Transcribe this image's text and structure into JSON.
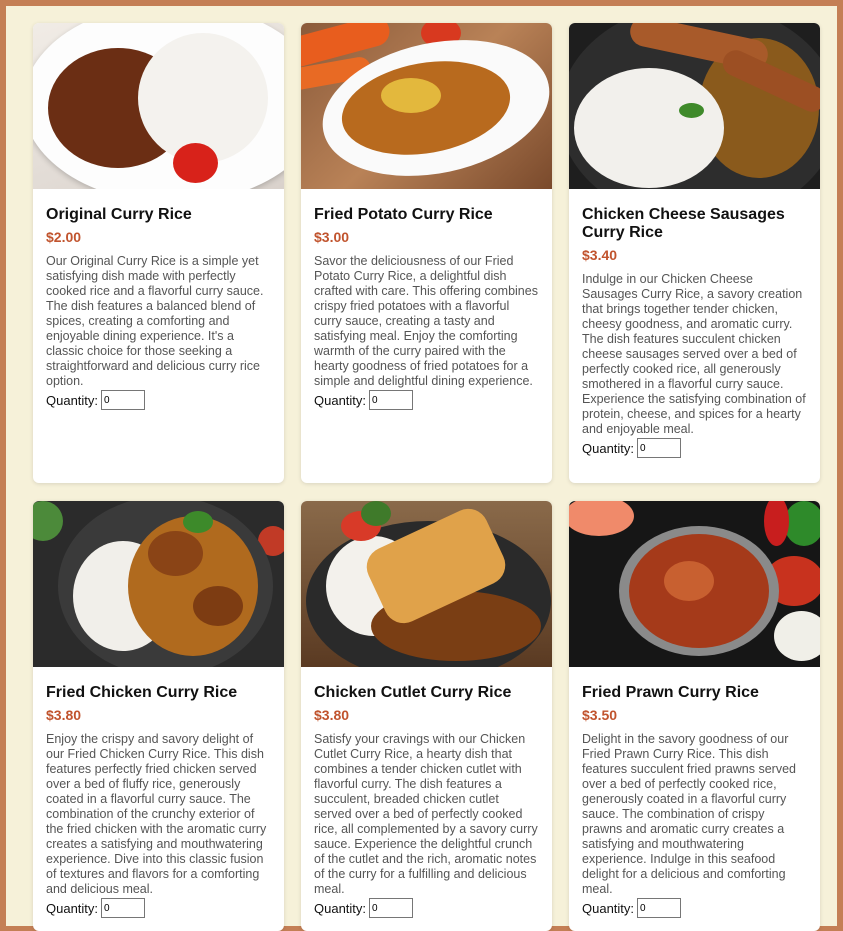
{
  "quantity_label": "Quantity:",
  "items": [
    {
      "name": "Original Curry Rice",
      "price": "$2.00",
      "description": "Our Original Curry Rice is a simple yet satisfying dish made with perfectly cooked rice and a flavorful curry sauce. The dish features a balanced blend of spices, creating a comforting and enjoyable dining experience. It's a classic choice for those seeking a straightforward and delicious curry rice option.",
      "quantity": "0"
    },
    {
      "name": "Fried Potato Curry Rice",
      "price": "$3.00",
      "description": "Savor the deliciousness of our Fried Potato Curry Rice, a delightful dish crafted with care. This offering combines crispy fried potatoes with a flavorful curry sauce, creating a tasty and satisfying meal. Enjoy the comforting warmth of the curry paired with the hearty goodness of fried potatoes for a simple and delightful dining experience.",
      "quantity": "0"
    },
    {
      "name": "Chicken Cheese Sausages Curry Rice",
      "price": "$3.40",
      "description": "Indulge in our Chicken Cheese Sausages Curry Rice, a savory creation that brings together tender chicken, cheesy goodness, and aromatic curry. The dish features succulent chicken cheese sausages served over a bed of perfectly cooked rice, all generously smothered in a flavorful curry sauce. Experience the satisfying combination of protein, cheese, and spices for a hearty and enjoyable meal.",
      "quantity": "0"
    },
    {
      "name": "Fried Chicken Curry Rice",
      "price": "$3.80",
      "description": "Enjoy the crispy and savory delight of our Fried Chicken Curry Rice. This dish features perfectly fried chicken served over a bed of fluffy rice, generously coated in a flavorful curry sauce. The combination of the crunchy exterior of the fried chicken with the aromatic curry creates a satisfying and mouthwatering experience. Dive into this classic fusion of textures and flavors for a comforting and delicious meal.",
      "quantity": "0"
    },
    {
      "name": "Chicken Cutlet Curry Rice",
      "price": "$3.80",
      "description": "Satisfy your cravings with our Chicken Cutlet Curry Rice, a hearty dish that combines a tender chicken cutlet with flavorful curry. The dish features a succulent, breaded chicken cutlet served over a bed of perfectly cooked rice, all complemented by a savory curry sauce. Experience the delightful crunch of the cutlet and the rich, aromatic notes of the curry for a fulfilling and delicious meal.",
      "quantity": "0"
    },
    {
      "name": "Fried Prawn Curry Rice",
      "price": "$3.50",
      "description": "Delight in the savory goodness of our Fried Prawn Curry Rice. This dish features succulent fried prawns served over a bed of perfectly cooked rice, generously coated in a flavorful curry sauce. The combination of crispy prawns and aromatic curry creates a satisfying and mouthwatering experience. Indulge in this seafood delight for a delicious and comforting meal.",
      "quantity": "0"
    }
  ]
}
